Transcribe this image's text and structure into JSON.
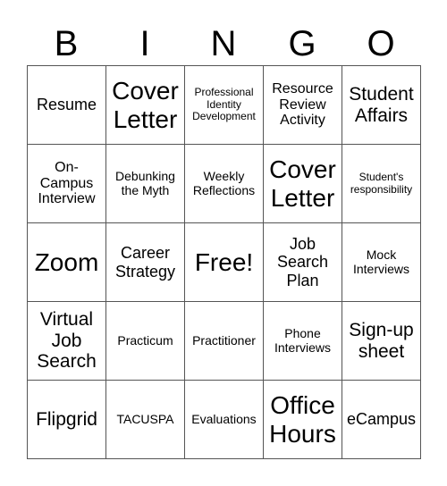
{
  "header": {
    "letters": [
      "B",
      "I",
      "N",
      "G",
      "O"
    ]
  },
  "board": {
    "rows": [
      [
        "Resume",
        "Cover Letter",
        "Professional Identity Development",
        "Resource Review Activity",
        "Student Affairs"
      ],
      [
        "On-Campus Interview",
        "Debunking the Myth",
        "Weekly Reflections",
        "Cover Letter",
        "Student's responsibility"
      ],
      [
        "Zoom",
        "Career Strategy",
        "Free!",
        "Job Search Plan",
        "Mock Interviews"
      ],
      [
        "Virtual Job Search",
        "Practicum",
        "Practitioner",
        "Phone Interviews",
        "Sign-up sheet"
      ],
      [
        "Flipgrid",
        "TACUSPA",
        "Evaluations",
        "Office Hours",
        "eCampus"
      ]
    ],
    "free_space": {
      "row": 2,
      "col": 2
    }
  }
}
